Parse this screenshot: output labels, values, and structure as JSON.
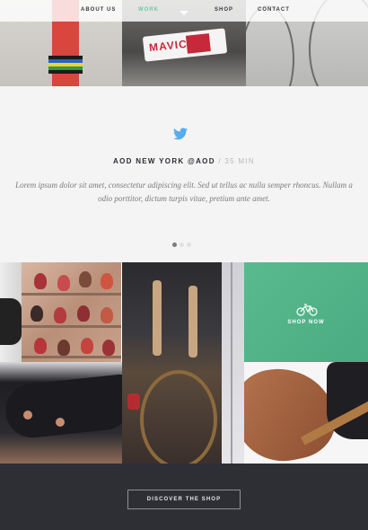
{
  "nav": {
    "items": [
      {
        "label": "ABOUT US",
        "active": false
      },
      {
        "label": "WORK",
        "active": true
      },
      {
        "label": "SHOP",
        "active": false
      },
      {
        "label": "CONTACT",
        "active": false
      }
    ],
    "accent_color": "#6cc8a0"
  },
  "hero": {
    "decal_text": "MAVIC"
  },
  "tweet": {
    "icon": "twitter-bird-icon",
    "icon_color": "#55acee",
    "author": "AOD NEW YORK @AOD",
    "separator": "/",
    "time": "35 MIN",
    "body": "Lorem ipsum dolor sit amet, consectetur adipiscing elit. Sed ut tellus ac nulla semper rhoncus. Nullam a odio porttitor, dictum turpis vitae, pretium ante amet.",
    "pagination": {
      "total": 3,
      "active": 1
    }
  },
  "grid": {
    "shop_tile": {
      "icon": "bicycle-icon",
      "label": "SHOP NOW",
      "color": "#5aba8f"
    }
  },
  "footer": {
    "cta_label": "DISCOVER THE SHOP",
    "background": "#2d2f34"
  }
}
